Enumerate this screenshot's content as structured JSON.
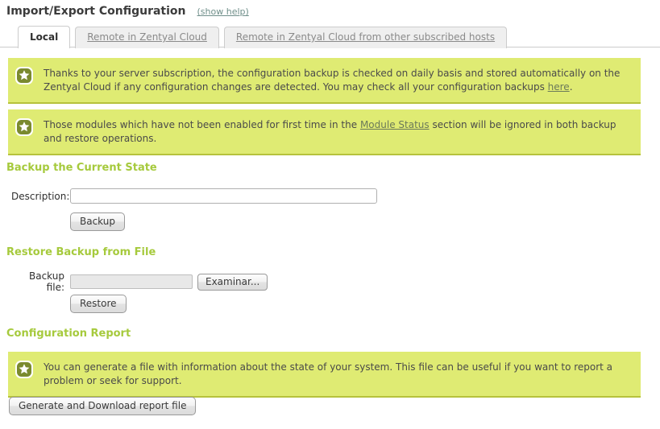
{
  "header": {
    "title": "Import/Export Configuration",
    "help_link": "(show help)"
  },
  "tabs": [
    {
      "label": "Local",
      "active": true
    },
    {
      "label": "Remote in Zentyal Cloud",
      "active": false
    },
    {
      "label": "Remote in Zentyal Cloud from other subscribed hosts",
      "active": false
    }
  ],
  "notes": [
    {
      "icon": "star-badge-icon",
      "text_before": "Thanks to your server subscription, the configuration backup is checked on daily basis and stored automatically on the Zentyal Cloud if any configuration changes are detected. You may check all your configuration backups ",
      "link": "here",
      "text_after": "."
    },
    {
      "icon": "star-badge-icon",
      "text_before": "Those modules which have not been enabled for first time in the ",
      "link": "Module Status",
      "text_after": " section will be ignored in both backup and restore operations."
    }
  ],
  "backup_section": {
    "title": "Backup the Current State",
    "description_label": "Description:",
    "description_value": "",
    "description_placeholder": "",
    "submit_label": "Backup"
  },
  "restore_section": {
    "title": "Restore Backup from File",
    "file_label": "Backup file:",
    "file_value": "",
    "browse_label": "Examinar...",
    "submit_label": "Restore"
  },
  "report_section": {
    "title": "Configuration Report",
    "note": {
      "icon": "star-badge-icon",
      "text": "You can generate a file with information about the state of your system. This file can be useful if you want to report a problem or seek for support."
    },
    "generate_label": "Generate and Download report file"
  },
  "colors": {
    "note_background": "#dfeb73",
    "note_border": "#b6c23c",
    "section_heading": "#a6ca3d",
    "help_link": "#6f8f8a",
    "note_link": "#6b7a5a"
  }
}
